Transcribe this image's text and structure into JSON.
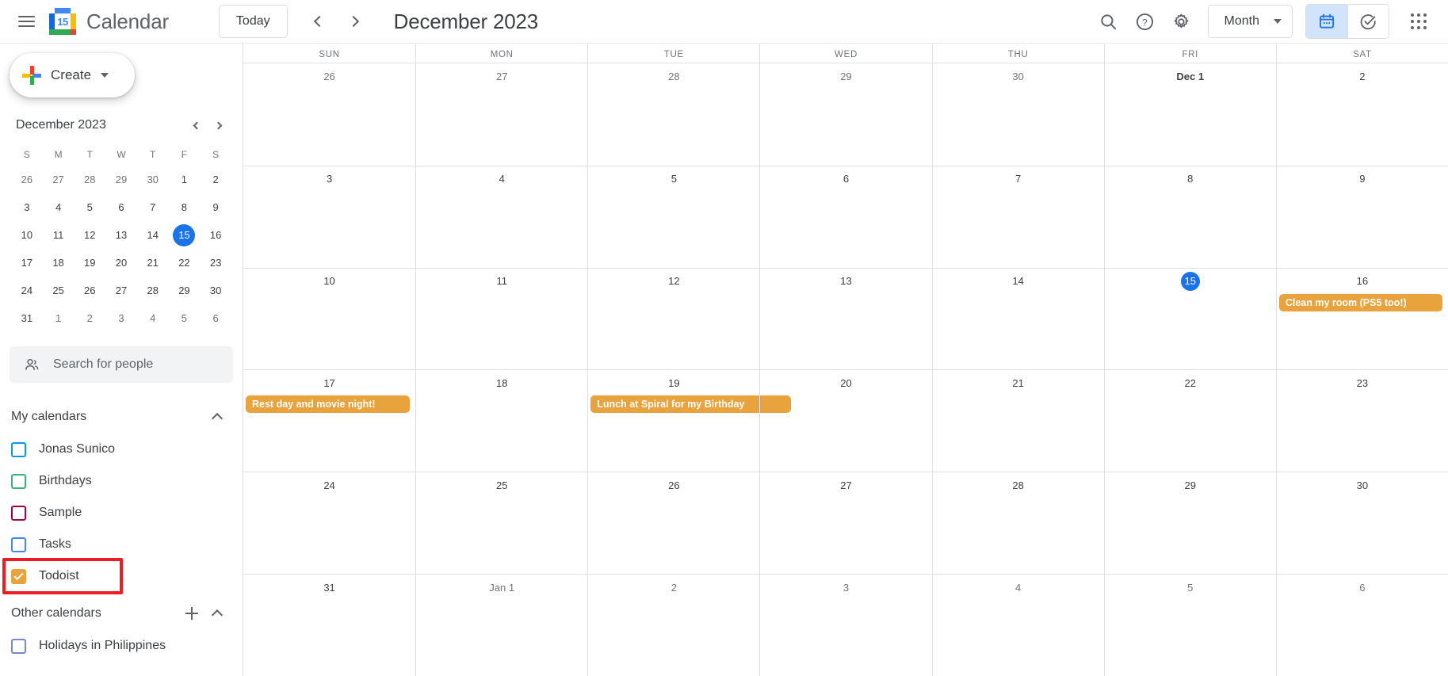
{
  "topbar": {
    "menu_icon": "hamburger-menu-icon",
    "logo": {
      "icon": "google-calendar-logo",
      "day_number": "15"
    },
    "app_title": "Calendar",
    "today_label": "Today",
    "prev_icon": "chevron-left-icon",
    "next_icon": "chevron-right-icon",
    "period_title": "December 2023",
    "search_icon": "search-icon",
    "help_icon": "help-icon",
    "settings_icon": "gear-icon",
    "view_label": "Month",
    "view_caret": "chevron-down-icon",
    "toggle_calendar_icon": "calendar-view-icon",
    "toggle_tasks_icon": "tasks-view-icon",
    "apps_icon": "google-apps-grid-icon",
    "active_toggle": "calendar"
  },
  "sidebar": {
    "create_label": "Create",
    "create_caret": "chevron-down-icon",
    "mini_calendar": {
      "title": "December 2023",
      "prev_icon": "chevron-left-icon",
      "next_icon": "chevron-right-icon",
      "dow": [
        "S",
        "M",
        "T",
        "W",
        "T",
        "F",
        "S"
      ],
      "weeks": [
        [
          {
            "d": "26",
            "m": true
          },
          {
            "d": "27",
            "m": true
          },
          {
            "d": "28",
            "m": true
          },
          {
            "d": "29",
            "m": true
          },
          {
            "d": "30",
            "m": true
          },
          {
            "d": "1",
            "m": false
          },
          {
            "d": "2",
            "m": false
          }
        ],
        [
          {
            "d": "3",
            "m": false
          },
          {
            "d": "4",
            "m": false
          },
          {
            "d": "5",
            "m": false
          },
          {
            "d": "6",
            "m": false
          },
          {
            "d": "7",
            "m": false
          },
          {
            "d": "8",
            "m": false
          },
          {
            "d": "9",
            "m": false
          }
        ],
        [
          {
            "d": "10",
            "m": false
          },
          {
            "d": "11",
            "m": false
          },
          {
            "d": "12",
            "m": false
          },
          {
            "d": "13",
            "m": false
          },
          {
            "d": "14",
            "m": false
          },
          {
            "d": "15",
            "m": false,
            "today": true
          },
          {
            "d": "16",
            "m": false
          }
        ],
        [
          {
            "d": "17",
            "m": false
          },
          {
            "d": "18",
            "m": false
          },
          {
            "d": "19",
            "m": false
          },
          {
            "d": "20",
            "m": false
          },
          {
            "d": "21",
            "m": false
          },
          {
            "d": "22",
            "m": false
          },
          {
            "d": "23",
            "m": false
          }
        ],
        [
          {
            "d": "24",
            "m": false
          },
          {
            "d": "25",
            "m": false
          },
          {
            "d": "26",
            "m": false
          },
          {
            "d": "27",
            "m": false
          },
          {
            "d": "28",
            "m": false
          },
          {
            "d": "29",
            "m": false
          },
          {
            "d": "30",
            "m": false
          }
        ],
        [
          {
            "d": "31",
            "m": false
          },
          {
            "d": "1",
            "m": true
          },
          {
            "d": "2",
            "m": true
          },
          {
            "d": "3",
            "m": true
          },
          {
            "d": "4",
            "m": true
          },
          {
            "d": "5",
            "m": true
          },
          {
            "d": "6",
            "m": true
          }
        ]
      ]
    },
    "people_search": {
      "icon": "people-icon",
      "placeholder": "Search for people"
    },
    "my_calendars": {
      "title": "My calendars",
      "collapse_icon": "chevron-up-icon",
      "items": [
        {
          "label": "Jonas Sunico",
          "color": "#039be5",
          "checked": false
        },
        {
          "label": "Birthdays",
          "color": "#33b679",
          "checked": false
        },
        {
          "label": "Sample",
          "color": "#a3004c",
          "checked": false
        },
        {
          "label": "Tasks",
          "color": "#4285f4",
          "checked": false
        },
        {
          "label": "Todoist",
          "color": "#e8a33d",
          "checked": true,
          "highlighted": true
        }
      ]
    },
    "other_calendars": {
      "title": "Other calendars",
      "add_icon": "plus-icon",
      "collapse_icon": "chevron-up-icon",
      "items": [
        {
          "label": "Holidays in Philippines",
          "color": "#7986cb",
          "checked": false
        }
      ]
    },
    "annotation_color": "#ee1c25"
  },
  "calendar_grid": {
    "day_headers": [
      "SUN",
      "MON",
      "TUE",
      "WED",
      "THU",
      "FRI",
      "SAT"
    ],
    "event_color": "#e8a33d",
    "weeks": [
      [
        {
          "num": "26",
          "muted": true
        },
        {
          "num": "27",
          "muted": true
        },
        {
          "num": "28",
          "muted": true
        },
        {
          "num": "29",
          "muted": true
        },
        {
          "num": "30",
          "muted": true
        },
        {
          "num": "Dec 1",
          "bold": true
        },
        {
          "num": "2"
        }
      ],
      [
        {
          "num": "3"
        },
        {
          "num": "4"
        },
        {
          "num": "5"
        },
        {
          "num": "6"
        },
        {
          "num": "7"
        },
        {
          "num": "8"
        },
        {
          "num": "9"
        }
      ],
      [
        {
          "num": "10"
        },
        {
          "num": "11"
        },
        {
          "num": "12"
        },
        {
          "num": "13"
        },
        {
          "num": "14"
        },
        {
          "num": "15",
          "today": true
        },
        {
          "num": "16",
          "events": [
            {
              "title": "Clean my room (PS5 too!)"
            }
          ]
        }
      ],
      [
        {
          "num": "17",
          "events": [
            {
              "title": "Rest day and movie night!"
            }
          ]
        },
        {
          "num": "18"
        },
        {
          "num": "19",
          "events": [
            {
              "title": "Lunch at Spiral for my Birthday",
              "overflow": true
            }
          ]
        },
        {
          "num": "20"
        },
        {
          "num": "21"
        },
        {
          "num": "22"
        },
        {
          "num": "23"
        }
      ],
      [
        {
          "num": "24"
        },
        {
          "num": "25"
        },
        {
          "num": "26"
        },
        {
          "num": "27"
        },
        {
          "num": "28"
        },
        {
          "num": "29"
        },
        {
          "num": "30"
        }
      ],
      [
        {
          "num": "31"
        },
        {
          "num": "Jan 1",
          "muted": true
        },
        {
          "num": "2",
          "muted": true
        },
        {
          "num": "3",
          "muted": true
        },
        {
          "num": "4",
          "muted": true
        },
        {
          "num": "5",
          "muted": true
        },
        {
          "num": "6",
          "muted": true
        }
      ]
    ]
  }
}
